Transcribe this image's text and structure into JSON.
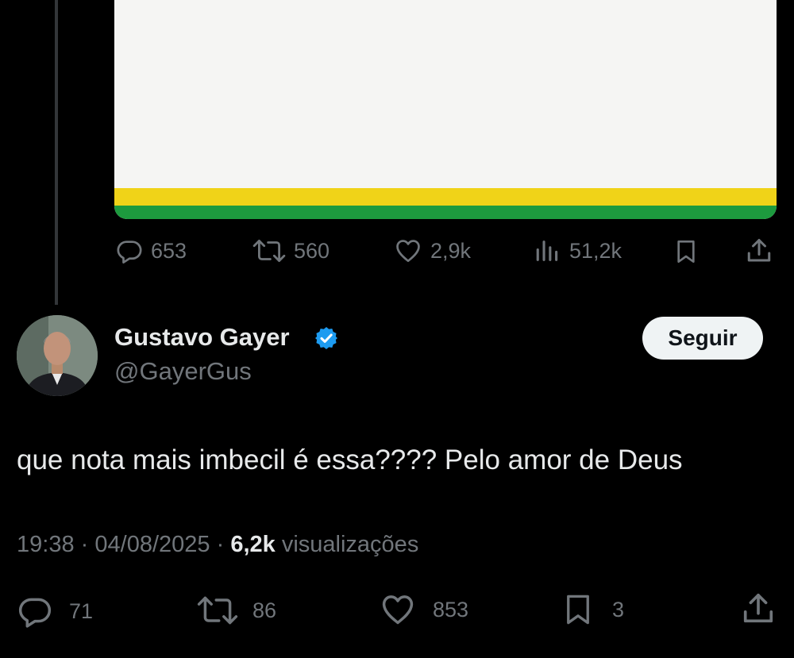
{
  "quoted_tweet": {
    "actions": {
      "replies": "653",
      "retweets": "560",
      "likes": "2,9k",
      "views": "51,2k"
    }
  },
  "tweet": {
    "author_name": "Gustavo Gayer",
    "author_handle": "@GayerGus",
    "follow_label": "Seguir",
    "text": "que nota mais imbecil é essa???? Pelo amor de Deus",
    "time": "19:38",
    "separator": "·",
    "date": "04/08/2025",
    "views_count": "6,2k",
    "views_label": "visualizações",
    "actions": {
      "replies": "71",
      "retweets": "86",
      "likes": "853",
      "bookmarks": "3"
    }
  },
  "colors": {
    "background": "#000000",
    "text_primary": "#e7e9ea",
    "text_secondary": "#71767b",
    "verified_blue": "#1d9bf0",
    "flag_yellow": "#f0d318",
    "flag_green": "#1d9a3e"
  },
  "icons": [
    "reply-icon",
    "retweet-icon",
    "like-icon",
    "views-icon",
    "bookmark-icon",
    "share-icon",
    "verified-badge-icon"
  ]
}
